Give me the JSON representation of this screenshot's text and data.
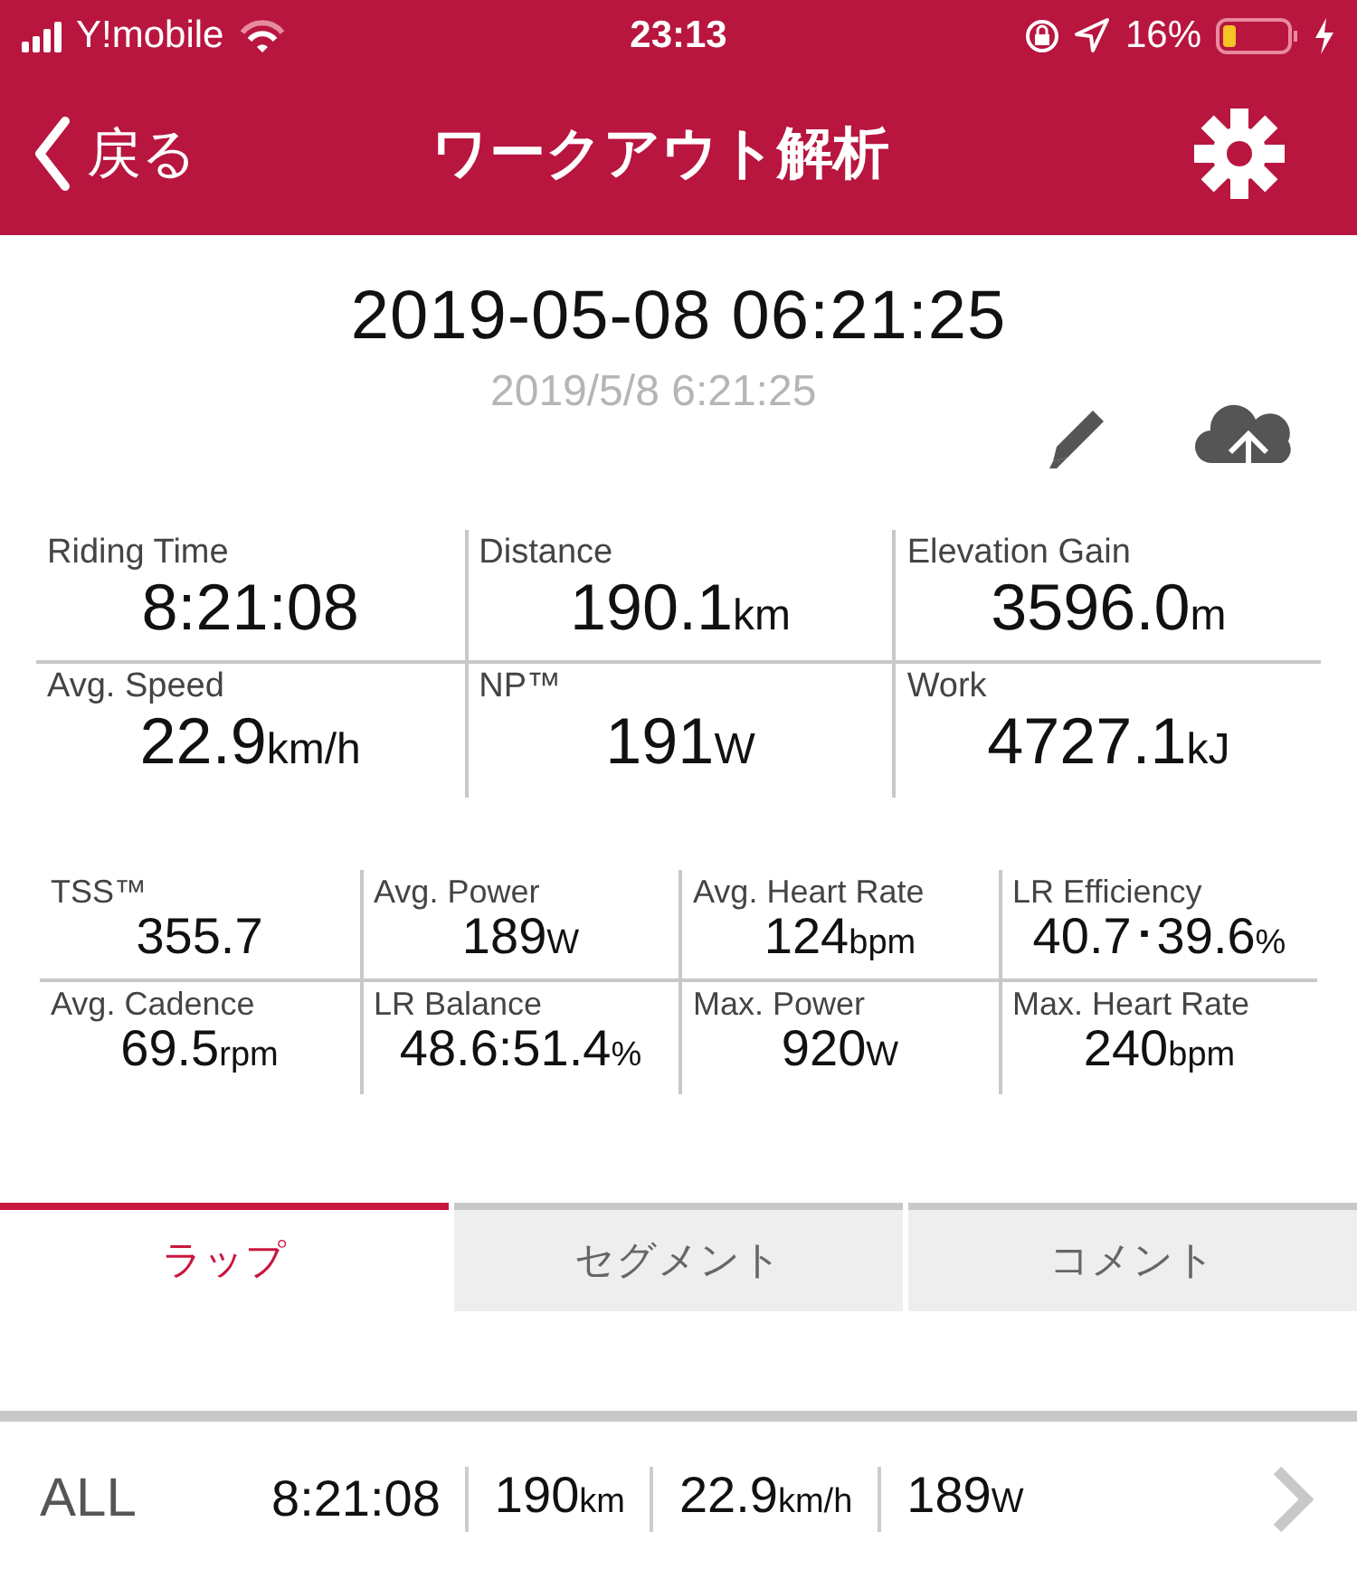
{
  "status_bar": {
    "carrier": "Y!mobile",
    "time": "23:13",
    "battery": "16%"
  },
  "nav": {
    "back": "戻る",
    "title": "ワークアウト解析"
  },
  "workout": {
    "title": "2019-05-08 06:21:25",
    "subtitle": "2019/5/8 6:21:25"
  },
  "summary": [
    {
      "label": "Riding Time",
      "value": "8:21:08"
    },
    {
      "label": "Distance",
      "value": "190.1",
      "unit": "km"
    },
    {
      "label": "Elevation Gain",
      "value": "3596.0",
      "unit": "m"
    },
    {
      "label": "Avg. Speed",
      "value": "22.9",
      "unit": "km/h"
    },
    {
      "label": "NP™",
      "value": "191",
      "unit": "W"
    },
    {
      "label": "Work",
      "value": "4727.1",
      "unit": "kJ"
    }
  ],
  "details": [
    {
      "label": "TSS™",
      "value": "355.7"
    },
    {
      "label": "Avg. Power",
      "value": "189",
      "unit": "W"
    },
    {
      "label": "Avg. Heart Rate",
      "value": "124",
      "unit": "bpm"
    },
    {
      "label": "LR Efficiency",
      "value": "40.7･39.6",
      "unit": "%"
    },
    {
      "label": "Avg. Cadence",
      "value": "69.5",
      "unit": "rpm"
    },
    {
      "label": "LR Balance",
      "value": "48.6:51.4",
      "unit": "%"
    },
    {
      "label": "Max. Power",
      "value": "920",
      "unit": "W"
    },
    {
      "label": "Max. Heart Rate",
      "value": "240",
      "unit": "bpm"
    }
  ],
  "tabs": [
    {
      "label": "ラップ",
      "selected": true
    },
    {
      "label": "セグメント",
      "selected": false
    },
    {
      "label": "コメント",
      "selected": false
    }
  ],
  "laps": [
    {
      "label": "ALL",
      "values": [
        {
          "value": "8:21:08"
        },
        {
          "value": "190",
          "unit": "km"
        },
        {
          "value": "22.9",
          "unit": "km/h"
        },
        {
          "value": "189",
          "unit": "W"
        }
      ]
    }
  ]
}
